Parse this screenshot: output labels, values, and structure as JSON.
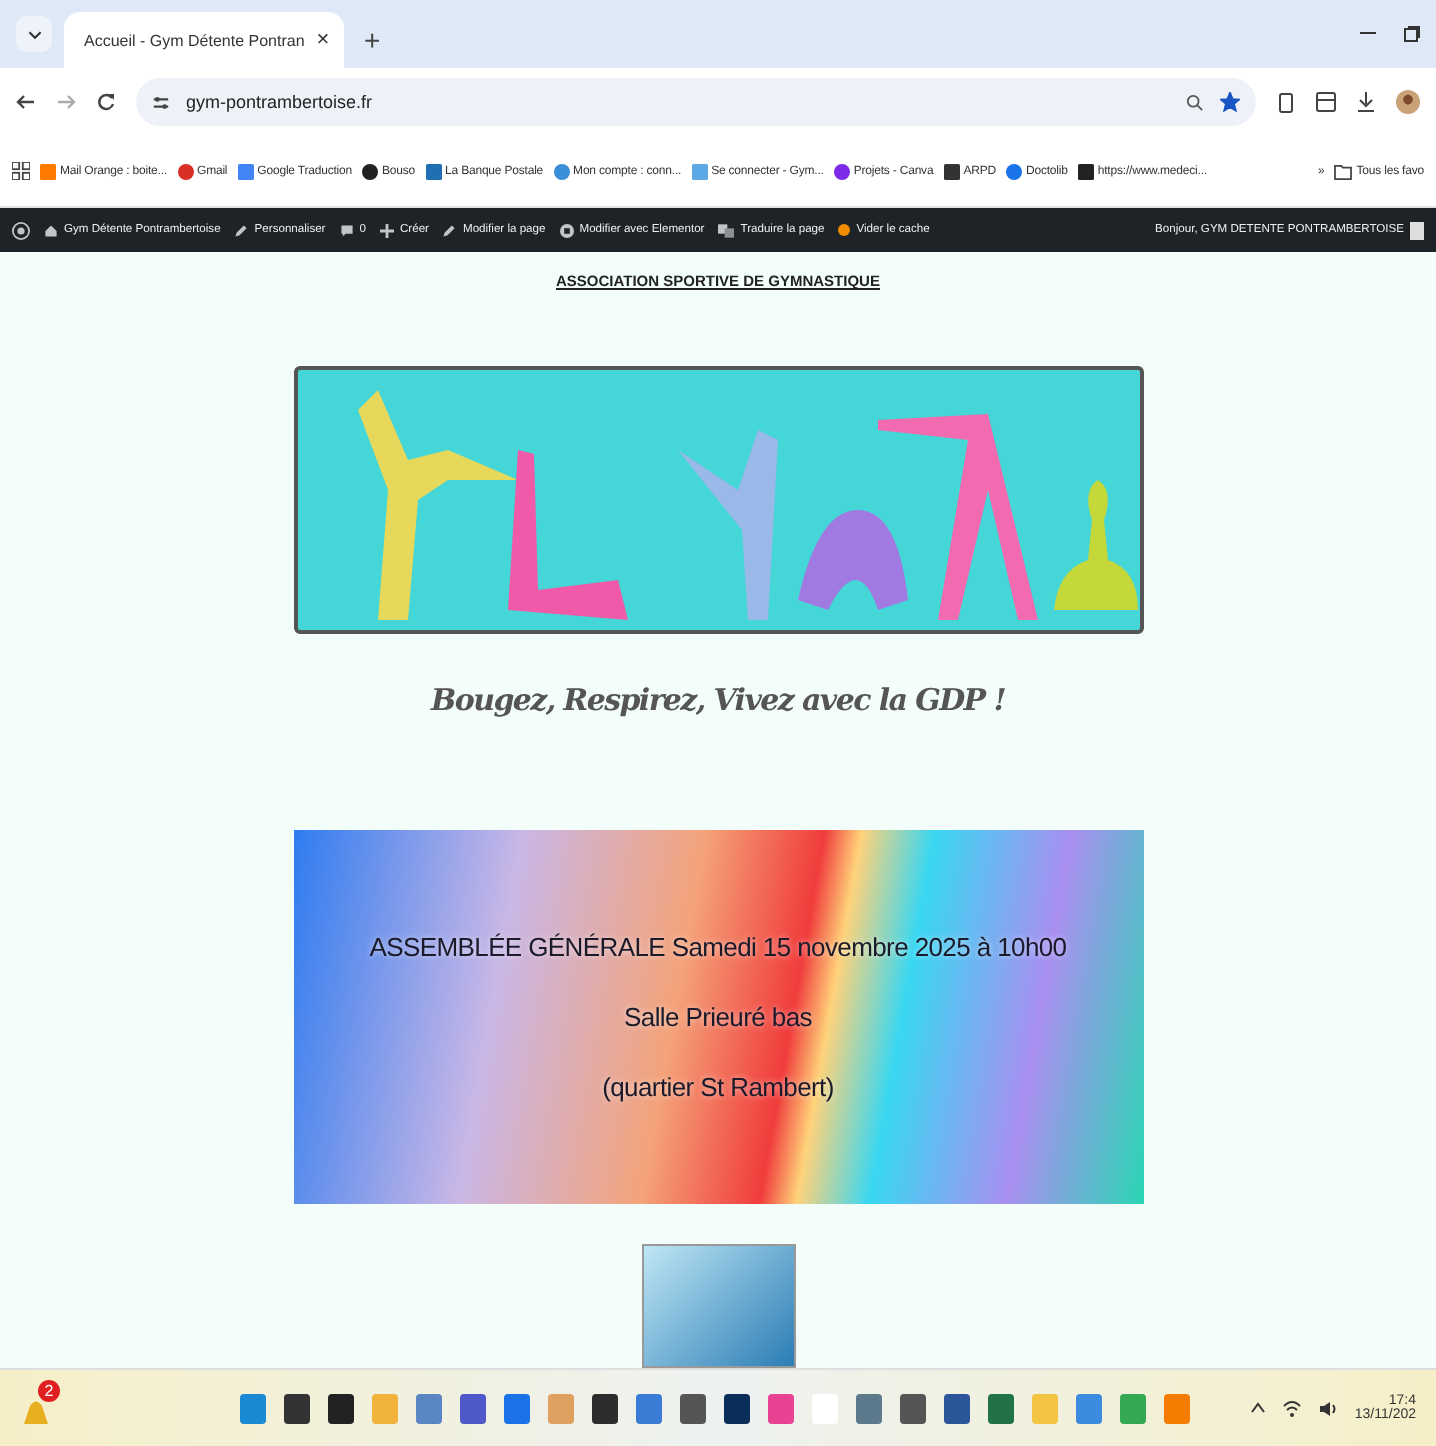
{
  "browser": {
    "tab": {
      "title": "Accueil - Gym Détente Pontran",
      "close": "×"
    },
    "new_tab": "+",
    "url": "gym-pontrambertoise.fr",
    "bookmarked": true
  },
  "bookmarks": [
    {
      "label": "Mail Orange : boite..."
    },
    {
      "label": "Gmail"
    },
    {
      "label": "Google Traduction"
    },
    {
      "label": "Bouso"
    },
    {
      "label": "La Banque Postale"
    },
    {
      "label": "Mon compte : conn..."
    },
    {
      "label": "Se connecter - Gym..."
    },
    {
      "label": "Projets - Canva"
    },
    {
      "label": "ARPD"
    },
    {
      "label": "Doctolib"
    },
    {
      "label": "https://www.medeci..."
    }
  ],
  "bookmarks_more": "»",
  "bookmarks_folder": "Tous les favo",
  "admin_bar": {
    "items": [
      {
        "kind": "site",
        "label": "Gym Détente Pontrambertoise"
      },
      {
        "kind": "edit",
        "label": "Personnaliser"
      },
      {
        "kind": "comments",
        "label": "0"
      },
      {
        "kind": "new",
        "label": "Créer"
      },
      {
        "kind": "edit",
        "label": "Modifier la page"
      },
      {
        "kind": "elementor",
        "label": "Modifier avec Elementor"
      },
      {
        "kind": "translate",
        "label": "Traduire la page"
      },
      {
        "kind": "cache",
        "label": "Vider le cache"
      }
    ],
    "greeting": "Bonjour, GYM DETENTE PONTRAMBERTOISE"
  },
  "page": {
    "heading": "ASSOCIATION SPORTIVE DE GYMNASTIQUE",
    "tagline": "Bougez, Respirez, Vivez avec la GDP !",
    "event": {
      "lines": [
        "ASSEMBLÉE GÉNÉRALE Samedi 15 novembre 2025 à 10h00",
        "Salle Prieuré bas",
        "(quartier St Rambert)"
      ]
    }
  },
  "taskbar": {
    "notification_count": "2",
    "time": "17:4",
    "date": "13/11/202"
  }
}
